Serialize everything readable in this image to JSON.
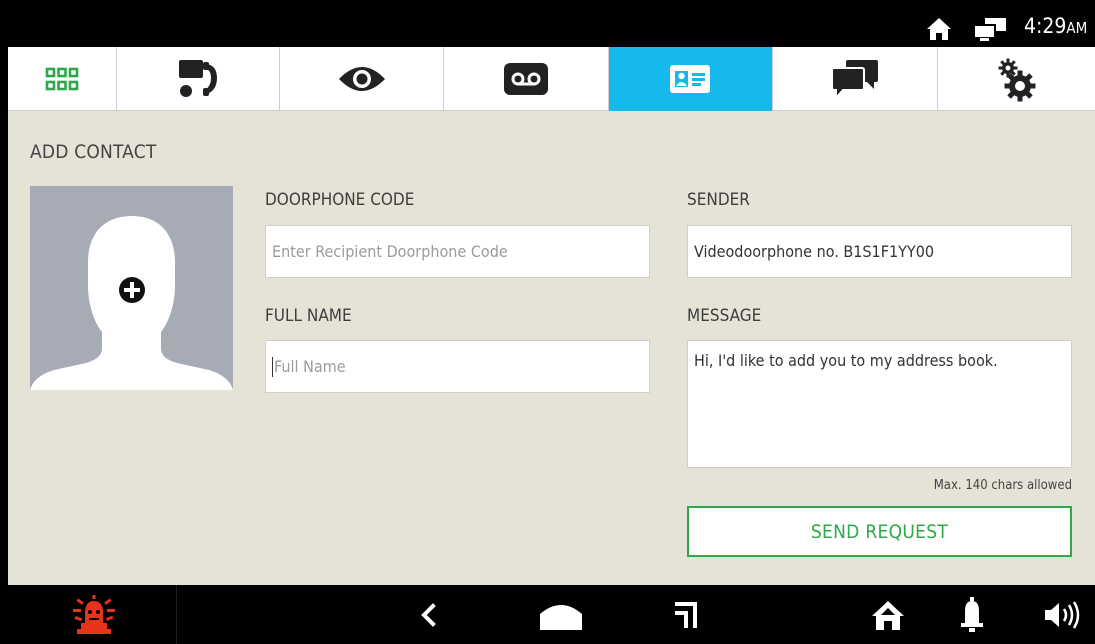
{
  "status_bar": {
    "time": "4:29",
    "ampm": "AM",
    "icons": [
      "home-icon",
      "network-icon"
    ]
  },
  "tabs": [
    {
      "name": "apps",
      "icon": "grid-icon",
      "active": false
    },
    {
      "name": "intercom",
      "icon": "intercom-icon",
      "active": false
    },
    {
      "name": "surveillance",
      "icon": "eye-icon",
      "active": false
    },
    {
      "name": "voicemail",
      "icon": "voicemail-icon",
      "active": false
    },
    {
      "name": "contacts",
      "icon": "contact-card-icon",
      "active": true
    },
    {
      "name": "messages",
      "icon": "chat-icon",
      "active": false
    },
    {
      "name": "settings",
      "icon": "gears-icon",
      "active": false
    }
  ],
  "page": {
    "title": "ADD CONTACT",
    "avatar_icon": "add-photo-icon",
    "doorphone_code": {
      "label": "DOORPHONE CODE",
      "placeholder": "Enter Recipient Doorphone Code",
      "value": ""
    },
    "full_name": {
      "label": "FULL NAME",
      "placeholder": "Full Name",
      "value": ""
    },
    "sender": {
      "label": "SENDER",
      "value": "Videodoorphone no. B1S1F1YY00"
    },
    "message": {
      "label": "MESSAGE",
      "value": "Hi, I'd like to add you to my address book."
    },
    "hint": "Max. 140 chars allowed",
    "send_button": "SEND REQUEST"
  },
  "nav_bar": {
    "icons": [
      "alarm-icon",
      "back-icon",
      "home-icon",
      "recent-apps-icon",
      "house-icon",
      "bell-icon",
      "volume-icon"
    ]
  },
  "colors": {
    "accent": "#17b8ec",
    "green": "#2fa84a",
    "background": "#e4e3d5",
    "alarm": "#e8331c"
  }
}
